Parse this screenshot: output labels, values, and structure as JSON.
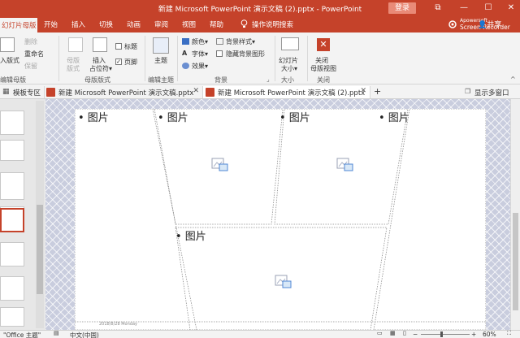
{
  "window": {
    "title": "新建 Microsoft PowerPoint 演示文稿 (2).pptx  -  PowerPoint",
    "login_label": "登录",
    "controls": [
      "⧉",
      "—",
      "☐",
      "✕"
    ]
  },
  "ribbon_tabs": {
    "active": "幻灯片母版",
    "items": [
      "开始",
      "插入",
      "切换",
      "动画",
      "审阅",
      "视图",
      "帮助"
    ],
    "tell_me": "操作说明搜索"
  },
  "recorder": {
    "line1": "Apowersoft",
    "line2": "Screen Recorder"
  },
  "share_label": "共享",
  "ribbon": {
    "edit_master": {
      "insert_layout": "入版式",
      "delete": "删除",
      "rename": "重命名",
      "preserve": "保留",
      "group": "编辑母版"
    },
    "master_layout": {
      "master_layout_btn_1": "母版",
      "master_layout_btn_2": "版式",
      "insert_placeholder_1": "插入",
      "insert_placeholder_2": "占位符▾",
      "title_check": "标题",
      "footer_check": "页脚",
      "group": "母版版式"
    },
    "edit_theme": {
      "themes": "主题",
      "group": "编辑主题"
    },
    "background": {
      "colors": "颜色▾",
      "fonts": "字体▾",
      "effects": "效果▾",
      "bg_styles": "背景样式▾",
      "hide_bg": "隐藏背景图形",
      "group": "背景"
    },
    "size": {
      "slide_size_1": "幻灯片",
      "slide_size_2": "大小▾",
      "group": "大小"
    },
    "close": {
      "close_1": "关闭",
      "close_2": "母版视图",
      "group": "关闭"
    }
  },
  "doc_tabs": {
    "template_zone": "模板专区",
    "tabs": [
      "新建 Microsoft PowerPoint 演示文稿.pptx",
      "新建 Microsoft PowerPoint 演示文稿 (2).pptx"
    ],
    "add": "+",
    "multi_window": "显示多窗口"
  },
  "slide": {
    "placeholders": [
      "• 图片",
      "• 图片",
      "• 图片",
      "• 图片",
      "• 图片"
    ],
    "footer_text": "2018/8/28 Monday"
  },
  "status": {
    "theme": "\"Office 主题\"",
    "language": "中文(中国)",
    "zoom": "60%"
  },
  "colors": {
    "accent": "#c5422a",
    "canvas": "#c9cdde"
  }
}
